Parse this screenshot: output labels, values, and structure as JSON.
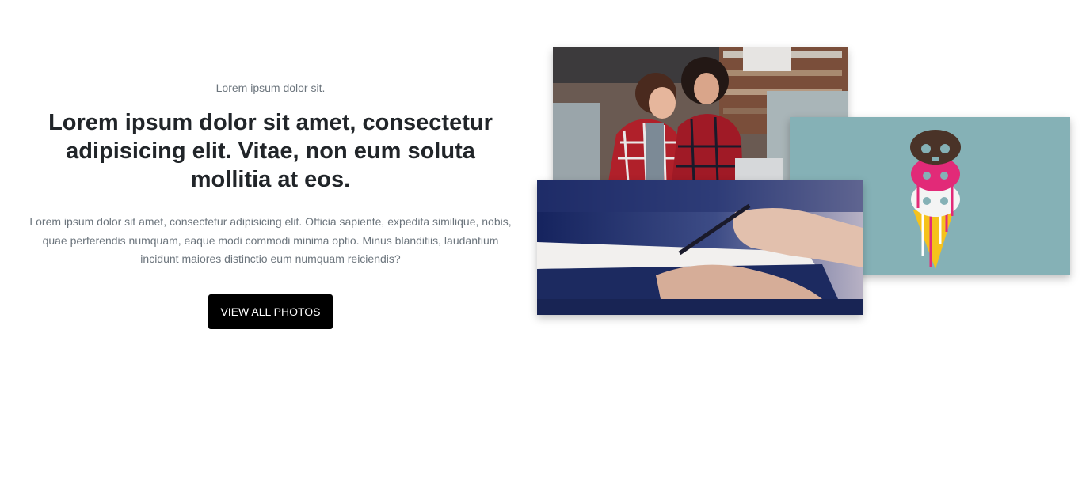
{
  "hero": {
    "eyebrow": "Lorem ipsum dolor sit.",
    "headline": "Lorem ipsum dolor sit amet, consectetur adipisicing elit. Vitae, non eum soluta mollitia at eos.",
    "body": "Lorem ipsum dolor sit amet, consectetur adipisicing elit. Officia sapiente, expedita similique, nobis, quae perferendis numquam, eaque modi commodi minima optio. Minus blanditiis, laudantium incidunt maiores distinctio eum numquam reiciendis?",
    "cta_label": "VIEW ALL PHOTOS"
  },
  "colors": {
    "cta_background": "#000000",
    "skull_panel": "#85b1b6",
    "writing_panel": "#1c2d6b"
  }
}
